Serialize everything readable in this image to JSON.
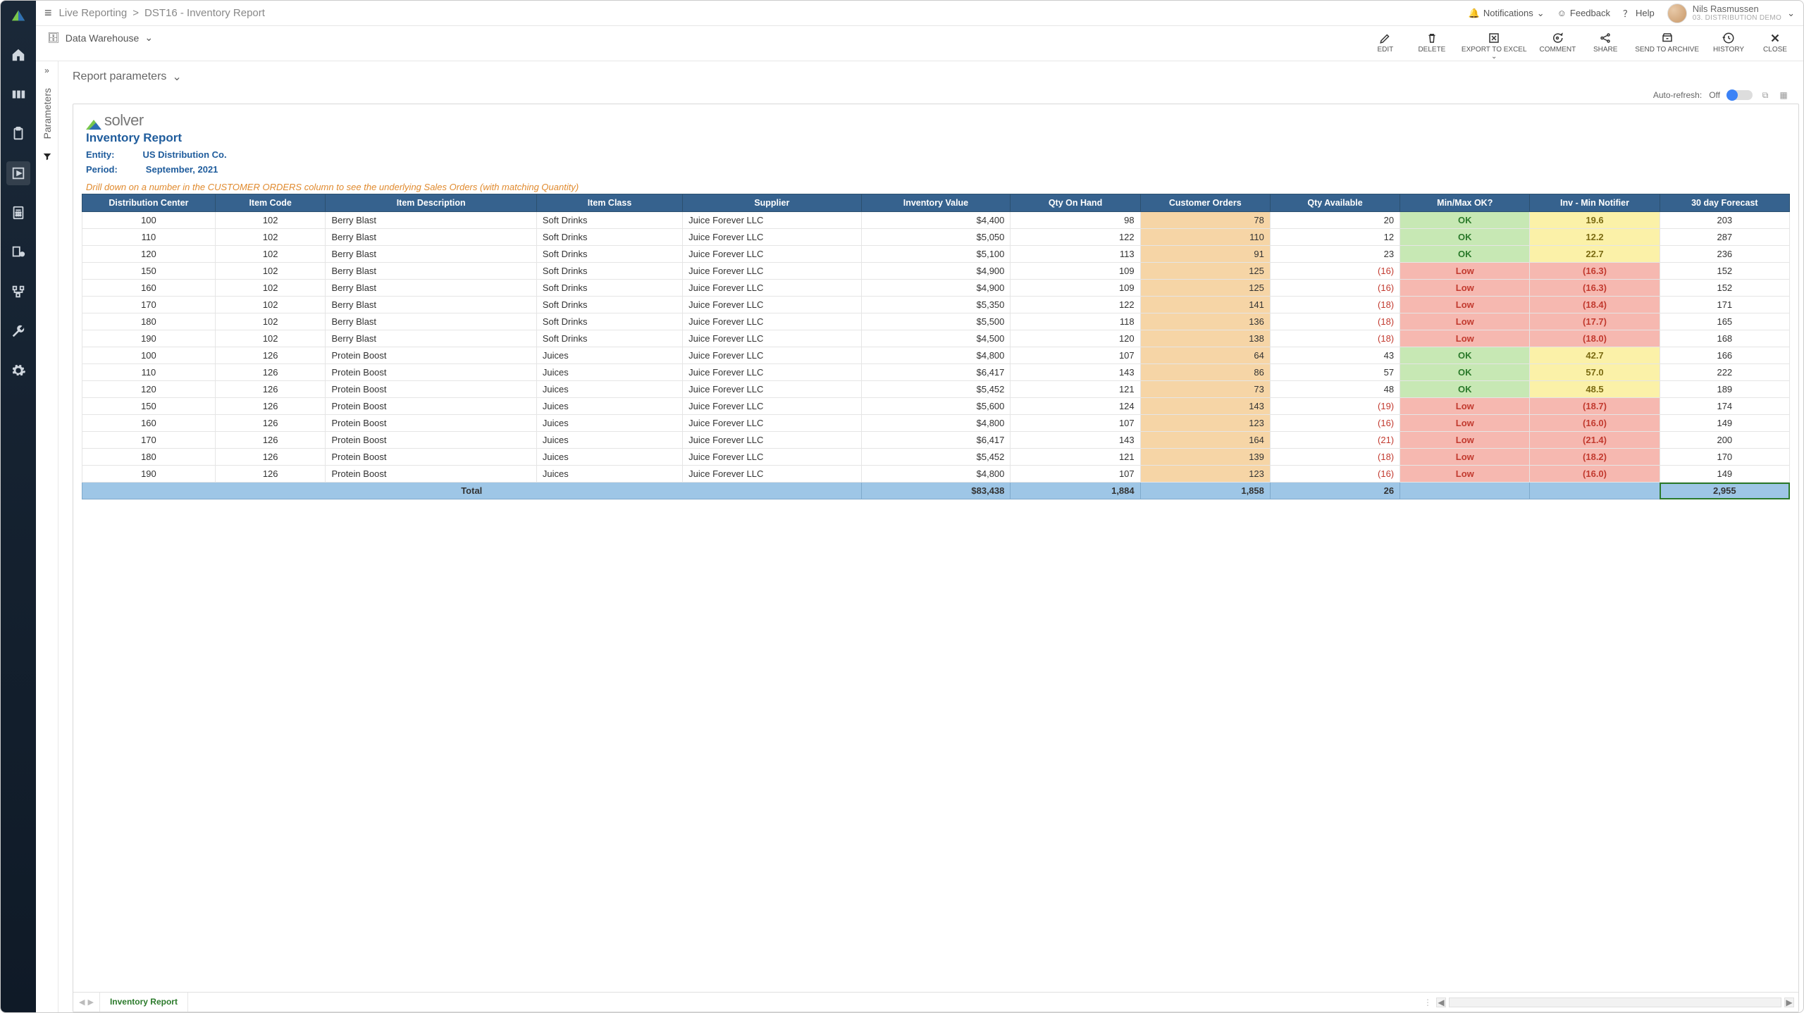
{
  "breadcrumb": {
    "root": "Live Reporting",
    "sep": ">",
    "current": "DST16 - Inventory Report"
  },
  "topRight": {
    "notifications": "Notifications",
    "feedback": "Feedback",
    "help": "Help",
    "user": {
      "name": "Nils Rasmussen",
      "org": "03. DISTRIBUTION DEMO"
    }
  },
  "dataSource": "Data Warehouse",
  "actions": {
    "edit": "EDIT",
    "delete": "DELETE",
    "export": "EXPORT TO EXCEL",
    "comment": "COMMENT",
    "share": "SHARE",
    "archive": "SEND TO ARCHIVE",
    "history": "HISTORY",
    "close": "CLOSE"
  },
  "paramRail": {
    "label": "Parameters"
  },
  "reportParams": "Report parameters",
  "autoRefresh": {
    "label": "Auto-refresh:",
    "state": "Off"
  },
  "logoText": "solver",
  "report": {
    "title": "Inventory Report",
    "entityLabel": "Entity:",
    "entity": "US Distribution Co.",
    "periodLabel": "Period:",
    "period": "September, 2021",
    "drillNote": "Drill down on a number in the CUSTOMER ORDERS column to see the underlying Sales Orders (with matching Quantity)"
  },
  "columns": {
    "dc": "Distribution Center",
    "code": "Item Code",
    "desc": "Item Description",
    "cls": "Item Class",
    "sup": "Supplier",
    "val": "Inventory Value",
    "qoh": "Qty On Hand",
    "cust": "Customer Orders",
    "avail": "Qty Available",
    "minmax": "Min/Max OK?",
    "notif": "Inv - Min Notifier",
    "fore": "30 day Forecast"
  },
  "rows": [
    {
      "dc": "100",
      "code": "102",
      "desc": "Berry Blast",
      "cls": "Soft Drinks",
      "sup": "Juice Forever LLC",
      "val": "$4,400",
      "qoh": "98",
      "cust": "78",
      "avail": "20",
      "mm": "OK",
      "not": "19.6",
      "fore": "203",
      "s": "ok"
    },
    {
      "dc": "110",
      "code": "102",
      "desc": "Berry Blast",
      "cls": "Soft Drinks",
      "sup": "Juice Forever LLC",
      "val": "$5,050",
      "qoh": "122",
      "cust": "110",
      "avail": "12",
      "mm": "OK",
      "not": "12.2",
      "fore": "287",
      "s": "ok"
    },
    {
      "dc": "120",
      "code": "102",
      "desc": "Berry Blast",
      "cls": "Soft Drinks",
      "sup": "Juice Forever LLC",
      "val": "$5,100",
      "qoh": "113",
      "cust": "91",
      "avail": "23",
      "mm": "OK",
      "not": "22.7",
      "fore": "236",
      "s": "ok"
    },
    {
      "dc": "150",
      "code": "102",
      "desc": "Berry Blast",
      "cls": "Soft Drinks",
      "sup": "Juice Forever LLC",
      "val": "$4,900",
      "qoh": "109",
      "cust": "125",
      "avail": "(16)",
      "mm": "Low",
      "not": "(16.3)",
      "fore": "152",
      "s": "low"
    },
    {
      "dc": "160",
      "code": "102",
      "desc": "Berry Blast",
      "cls": "Soft Drinks",
      "sup": "Juice Forever LLC",
      "val": "$4,900",
      "qoh": "109",
      "cust": "125",
      "avail": "(16)",
      "mm": "Low",
      "not": "(16.3)",
      "fore": "152",
      "s": "low"
    },
    {
      "dc": "170",
      "code": "102",
      "desc": "Berry Blast",
      "cls": "Soft Drinks",
      "sup": "Juice Forever LLC",
      "val": "$5,350",
      "qoh": "122",
      "cust": "141",
      "avail": "(18)",
      "mm": "Low",
      "not": "(18.4)",
      "fore": "171",
      "s": "low"
    },
    {
      "dc": "180",
      "code": "102",
      "desc": "Berry Blast",
      "cls": "Soft Drinks",
      "sup": "Juice Forever LLC",
      "val": "$5,500",
      "qoh": "118",
      "cust": "136",
      "avail": "(18)",
      "mm": "Low",
      "not": "(17.7)",
      "fore": "165",
      "s": "low"
    },
    {
      "dc": "190",
      "code": "102",
      "desc": "Berry Blast",
      "cls": "Soft Drinks",
      "sup": "Juice Forever LLC",
      "val": "$4,500",
      "qoh": "120",
      "cust": "138",
      "avail": "(18)",
      "mm": "Low",
      "not": "(18.0)",
      "fore": "168",
      "s": "low"
    },
    {
      "dc": "100",
      "code": "126",
      "desc": "Protein Boost",
      "cls": "Juices",
      "sup": "Juice Forever LLC",
      "val": "$4,800",
      "qoh": "107",
      "cust": "64",
      "avail": "43",
      "mm": "OK",
      "not": "42.7",
      "fore": "166",
      "s": "ok"
    },
    {
      "dc": "110",
      "code": "126",
      "desc": "Protein Boost",
      "cls": "Juices",
      "sup": "Juice Forever LLC",
      "val": "$6,417",
      "qoh": "143",
      "cust": "86",
      "avail": "57",
      "mm": "OK",
      "not": "57.0",
      "fore": "222",
      "s": "ok"
    },
    {
      "dc": "120",
      "code": "126",
      "desc": "Protein Boost",
      "cls": "Juices",
      "sup": "Juice Forever LLC",
      "val": "$5,452",
      "qoh": "121",
      "cust": "73",
      "avail": "48",
      "mm": "OK",
      "not": "48.5",
      "fore": "189",
      "s": "ok"
    },
    {
      "dc": "150",
      "code": "126",
      "desc": "Protein Boost",
      "cls": "Juices",
      "sup": "Juice Forever LLC",
      "val": "$5,600",
      "qoh": "124",
      "cust": "143",
      "avail": "(19)",
      "mm": "Low",
      "not": "(18.7)",
      "fore": "174",
      "s": "low"
    },
    {
      "dc": "160",
      "code": "126",
      "desc": "Protein Boost",
      "cls": "Juices",
      "sup": "Juice Forever LLC",
      "val": "$4,800",
      "qoh": "107",
      "cust": "123",
      "avail": "(16)",
      "mm": "Low",
      "not": "(16.0)",
      "fore": "149",
      "s": "low"
    },
    {
      "dc": "170",
      "code": "126",
      "desc": "Protein Boost",
      "cls": "Juices",
      "sup": "Juice Forever LLC",
      "val": "$6,417",
      "qoh": "143",
      "cust": "164",
      "avail": "(21)",
      "mm": "Low",
      "not": "(21.4)",
      "fore": "200",
      "s": "low"
    },
    {
      "dc": "180",
      "code": "126",
      "desc": "Protein Boost",
      "cls": "Juices",
      "sup": "Juice Forever LLC",
      "val": "$5,452",
      "qoh": "121",
      "cust": "139",
      "avail": "(18)",
      "mm": "Low",
      "not": "(18.2)",
      "fore": "170",
      "s": "low"
    },
    {
      "dc": "190",
      "code": "126",
      "desc": "Protein Boost",
      "cls": "Juices",
      "sup": "Juice Forever LLC",
      "val": "$4,800",
      "qoh": "107",
      "cust": "123",
      "avail": "(16)",
      "mm": "Low",
      "not": "(16.0)",
      "fore": "149",
      "s": "low"
    }
  ],
  "totals": {
    "label": "Total",
    "val": "$83,438",
    "qoh": "1,884",
    "cust": "1,858",
    "avail": "26",
    "fore": "2,955"
  },
  "tab": "Inventory Report"
}
